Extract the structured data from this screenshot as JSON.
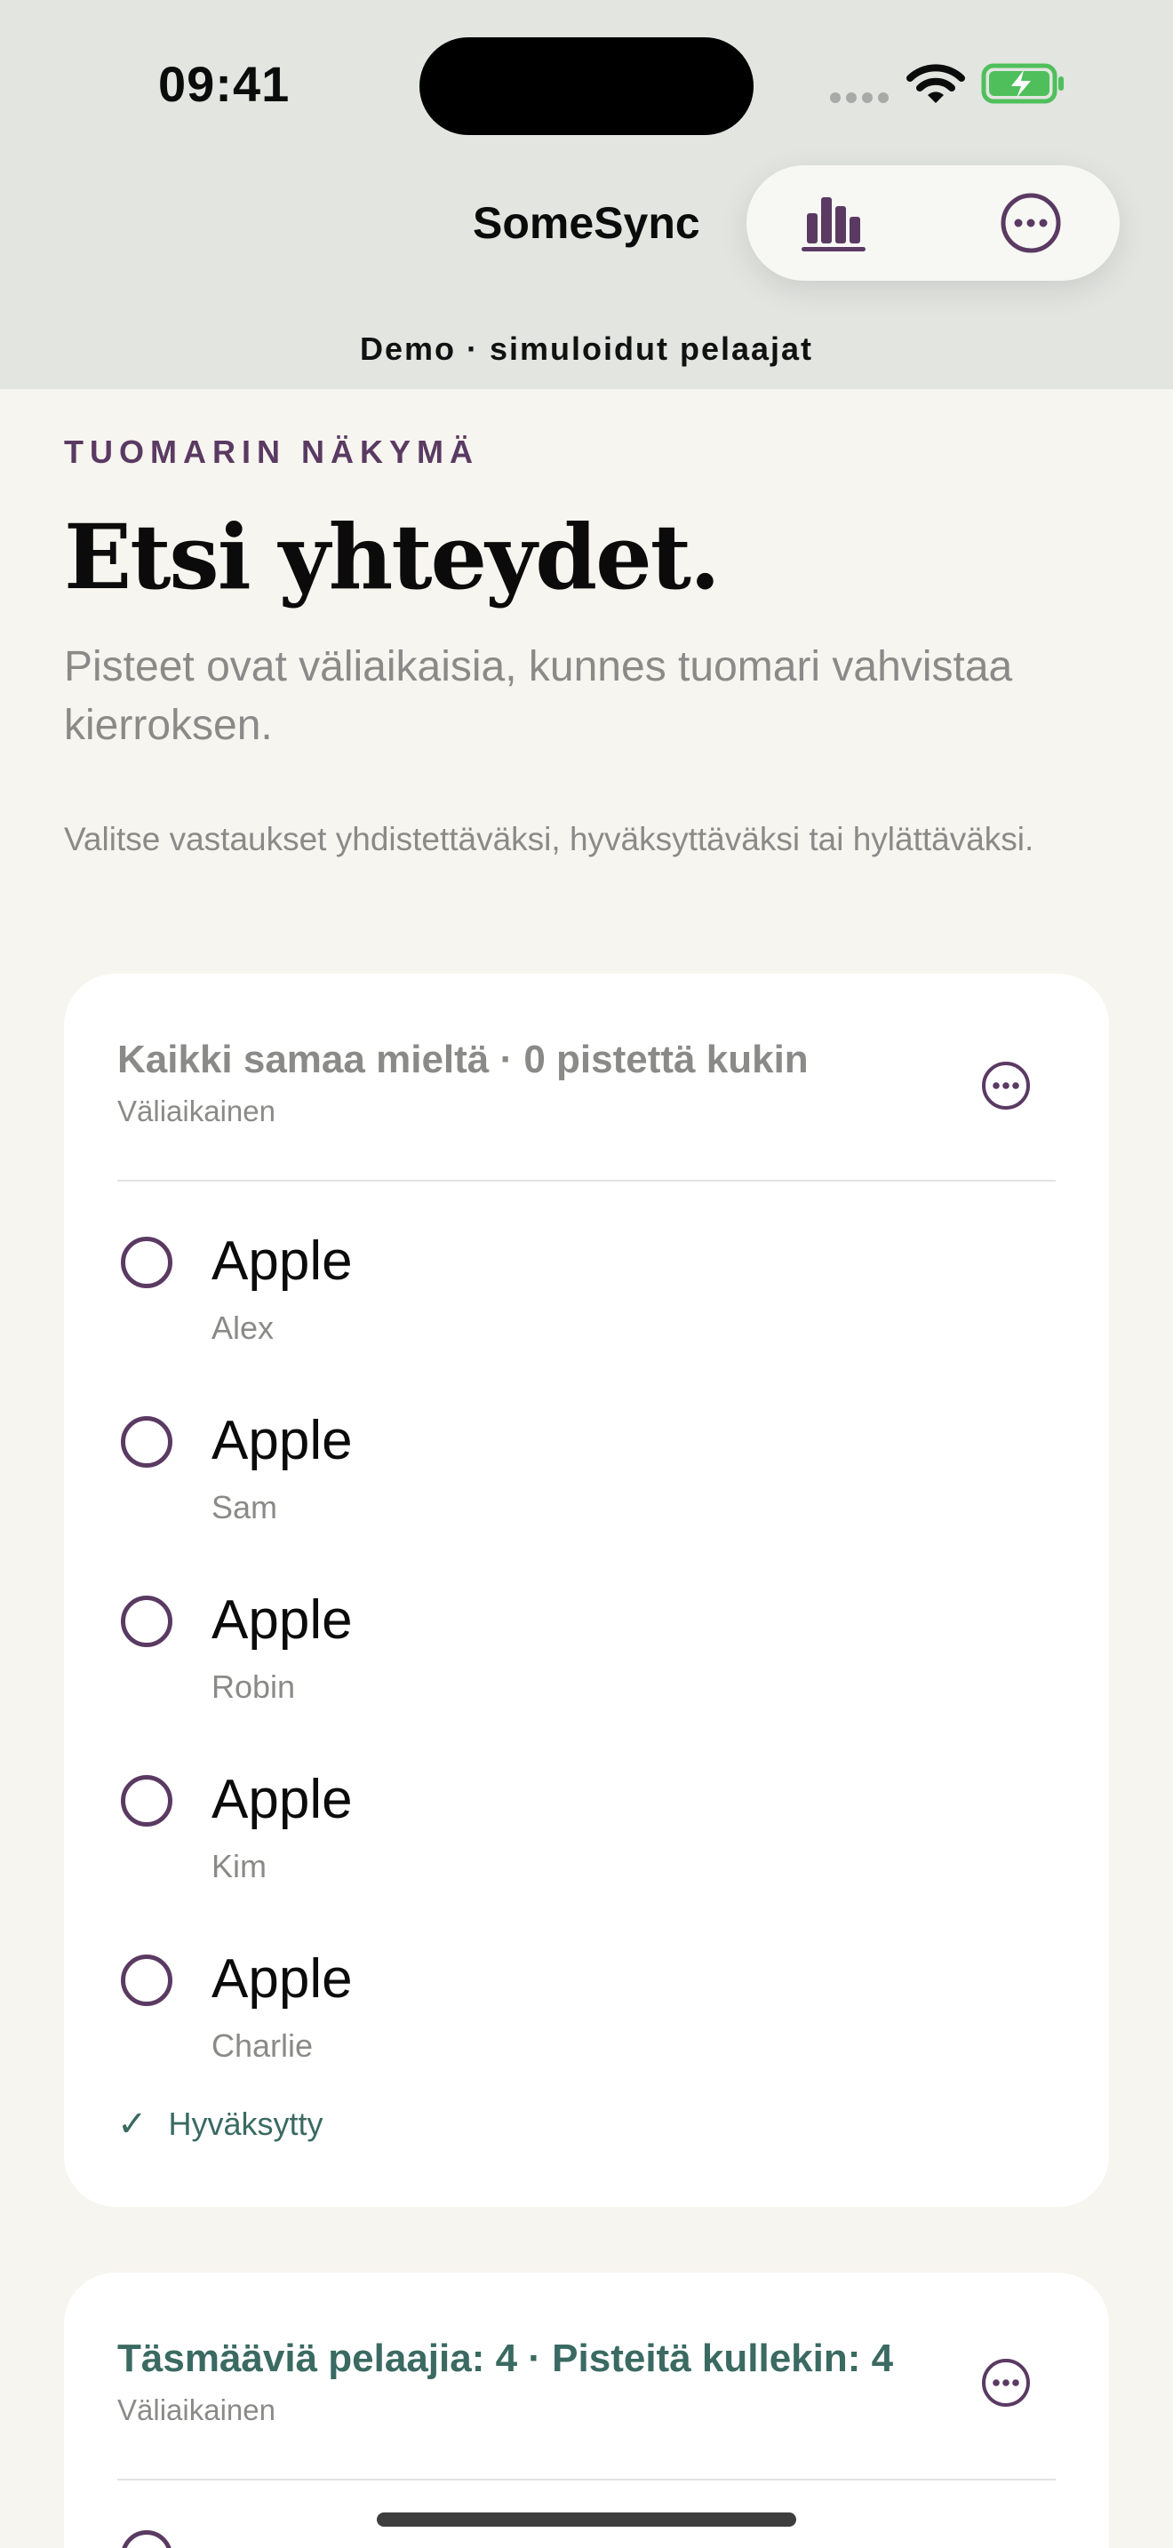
{
  "status": {
    "time": "09:41"
  },
  "nav": {
    "title": "SomeSync"
  },
  "demo_label": "Demo · simuloidut pelaajat",
  "header": {
    "eyebrow": "TUOMARIN NÄKYMÄ",
    "title": "Etsi yhteydet.",
    "subtitle": "Pisteet ovat väliaikaisia, kunnes tuomari vahvistaa kierroksen.",
    "hint": "Valitse vastaukset yhdistettäväksi, hyväksyttäväksi tai hylättäväksi."
  },
  "groups": [
    {
      "title": "Kaikki samaa mieltä · 0 pistettä kukin",
      "status": "Väliaikainen",
      "answers": [
        {
          "word": "Apple",
          "player": "Alex"
        },
        {
          "word": "Apple",
          "player": "Sam"
        },
        {
          "word": "Apple",
          "player": "Robin"
        },
        {
          "word": "Apple",
          "player": "Kim"
        },
        {
          "word": "Apple",
          "player": "Charlie"
        }
      ],
      "approved_label": "Hyväksytty"
    },
    {
      "title": "Täsmääviä pelaajia: 4 · Pisteitä kullekin: 4",
      "status": "Väliaikainen"
    }
  ],
  "colors": {
    "accent": "#5a3a62",
    "success": "#3a6a62",
    "muted": "#8a8a88",
    "background": "#f7f5ef"
  }
}
